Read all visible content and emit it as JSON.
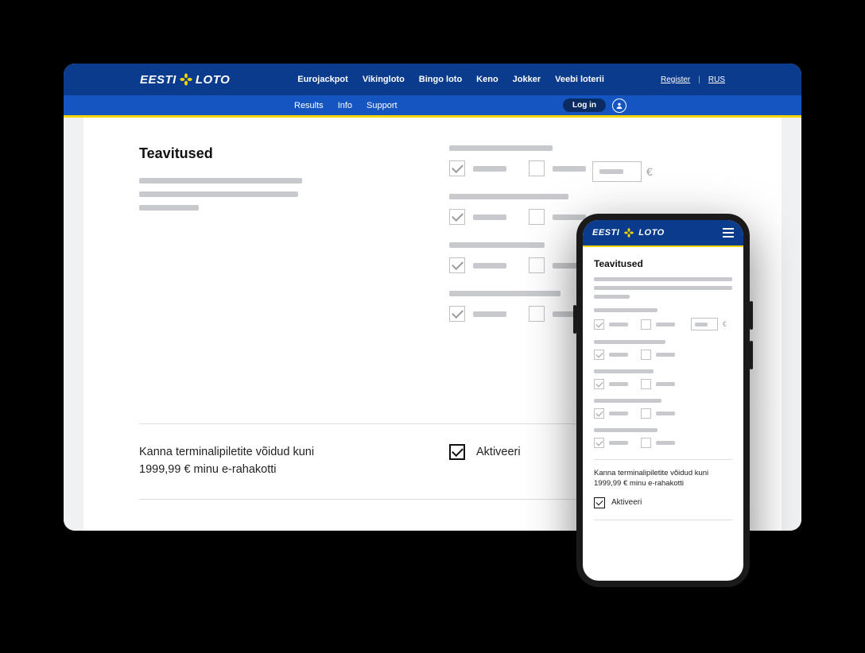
{
  "brand": {
    "word1": "EESTI",
    "word2": "LOTO"
  },
  "nav": {
    "items": [
      "Eurojackpot",
      "Vikingloto",
      "Bingo loto",
      "Keno",
      "Jokker",
      "Veebi loterii"
    ]
  },
  "header_links": {
    "register": "Register",
    "lang": "RUS"
  },
  "subnav": {
    "items": [
      "Results",
      "Info",
      "Support"
    ],
    "login": "Log in"
  },
  "page": {
    "title": "Teavitused",
    "transfer_text_l1": "Kanna terminalipiletite võidud kuni",
    "transfer_text_l2": "1999,99 € minu e-rahakotti",
    "activate_label": "Aktiveeri",
    "currency": "€"
  },
  "mobile": {
    "title": "Teavitused",
    "transfer_text": "Kanna terminalipiletite võidud kuni 1999,99 € minu e-rahakotti",
    "activate_label": "Aktiveeri",
    "currency": "€"
  }
}
